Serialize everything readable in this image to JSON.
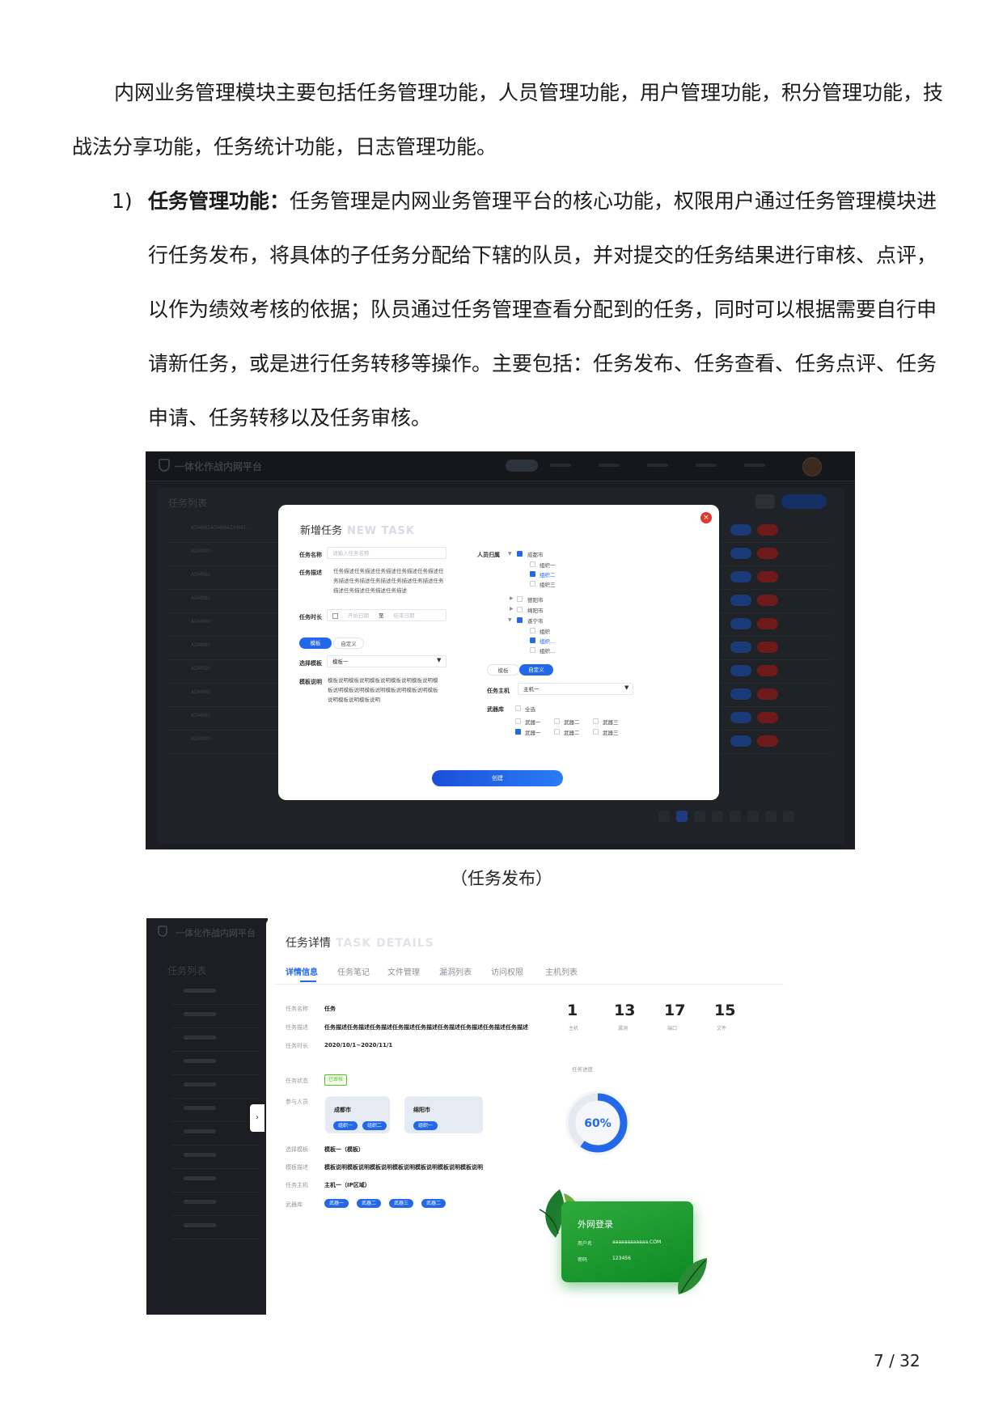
{
  "intro": {
    "line1": "内网业务管理模块主要包括任务管理功能，人员管理功能，用户管理功能，积分管理功能，技",
    "line2": "战法分享功能，任务统计功能，日志管理功能。"
  },
  "item1": {
    "number": "1)",
    "heading": "任务管理功能：",
    "line1": "任务管理是内网业务管理平台的核心功能，权限用户通过任务管理模块进",
    "line2": "行任务发布，将具体的子任务分配给下辖的队员，并对提交的任务结果进行审核、点评，",
    "line3": "以作为绩效考核的依据；队员通过任务管理查看分配到的任务，同时可以根据需要自行申",
    "line4": "请新任务，或是进行任务转移等操作。主要包括：任务发布、任务查看、任务点评、任务",
    "line5": "申请、任务转移以及任务审核。"
  },
  "shot1": {
    "app_title": "一体化作战内网平台",
    "list_title": "任务列表",
    "row_ids": [
      "ADMIN1ADMINADMINT...",
      "ADMIN0",
      "ADMIN0",
      "ADMIN0",
      "ADMIN0",
      "ADMIN0",
      "ADMIN0",
      "ADMIN0",
      "ADMIN0",
      "ADMIN0"
    ],
    "modal": {
      "title": "新增任务",
      "title_en": "NEW TASK",
      "close_icon": "×",
      "task_name_label": "任务名称",
      "task_name_placeholder": "请输入任务名称",
      "task_desc_label": "任务描述",
      "task_desc_text": "任务描述任务描述任务描述任务描述任务描述任务描述任务描述任务描述任务描述任务描述任务描述任务描述任务描述任务描述",
      "task_time_label": "任务时长",
      "start_date": "开始日期",
      "date_sep": "至",
      "end_date": "结束日期",
      "mode_tabs": [
        "模板",
        "自定义"
      ],
      "template_label": "选择模板",
      "template_value": "模板一",
      "template_desc_label": "模板说明",
      "template_desc_text": "模板说明模板说明模板说明模板说明模板说明模板说明模板说明模板说明模板说明模板说明模板说明模板说明模板说明",
      "people_label": "人员归属",
      "tree": {
        "city1": "成都市",
        "c1_groups": [
          "组织一",
          "组织二",
          "组织三"
        ],
        "city2": "德阳市",
        "city3": "绵阳市",
        "city4": "遂宁市",
        "c4_groups": [
          "组织",
          "组织...",
          "组织..."
        ]
      },
      "mode_tabs2": [
        "模板",
        "自定义"
      ],
      "host_label": "任务主机",
      "host_value": "主机一",
      "arsenal_label": "武器库",
      "select_all": "全选",
      "weapons": [
        "武器一",
        "武器二",
        "武器三",
        "武器一",
        "武器二",
        "武器三"
      ],
      "create_button": "创建"
    }
  },
  "caption": "（任务发布）",
  "shot2": {
    "app_title": "一体化作战内网平台",
    "list_title": "任务列表",
    "handle_icon": "›",
    "detail_title": "任务详情",
    "detail_title_en": "TASK DETAILS",
    "tabs": [
      "详情信息",
      "任务笔记",
      "文件管理",
      "漏洞列表",
      "访问权限",
      "主机列表"
    ],
    "fields": {
      "name_label": "任务名称",
      "name_value": "任务",
      "desc_label": "任务描述",
      "desc_value": "任务描述任务描述任务描述任务描述任务描述任务描述任务描述任务描述任务描述",
      "time_label": "任务时长",
      "time_value": "2020/10/1~2020/11/1",
      "status_label": "任务状态",
      "status_value": "已审核",
      "people_label": "参与人员",
      "template_label": "选择模板",
      "template_value": "模板一（模板）",
      "tdesc_label": "模板描述",
      "tdesc_value": "模板说明模板说明模板说明模板说明模板说明模板说明模板说明",
      "host_label": "任务主机",
      "host_value": "主机一（IP区域）",
      "arsenal_label": "武器库",
      "weapons": [
        "武器一",
        "武器二",
        "武器三",
        "武器二"
      ]
    },
    "cards": [
      {
        "title": "成都市",
        "chips": [
          "组织一",
          "组织二"
        ]
      },
      {
        "title": "绵阳市",
        "chips": [
          "组织一"
        ]
      }
    ],
    "stats": [
      {
        "value": "1",
        "label": "主机"
      },
      {
        "value": "13",
        "label": "漏洞"
      },
      {
        "value": "17",
        "label": "端口"
      },
      {
        "value": "15",
        "label": "文件"
      }
    ],
    "progress_label": "任务进度",
    "progress_text": "60%",
    "progress_value": 0.6,
    "login": {
      "title": "外网登录",
      "account_label": "用户名",
      "account_value": "aaaaaaaaaaaa.COM",
      "password_label": "密码",
      "password_value": "123456"
    },
    "accent_color": "#2268e8",
    "login_color": "#1f9e33"
  },
  "page_number": "7 / 32"
}
